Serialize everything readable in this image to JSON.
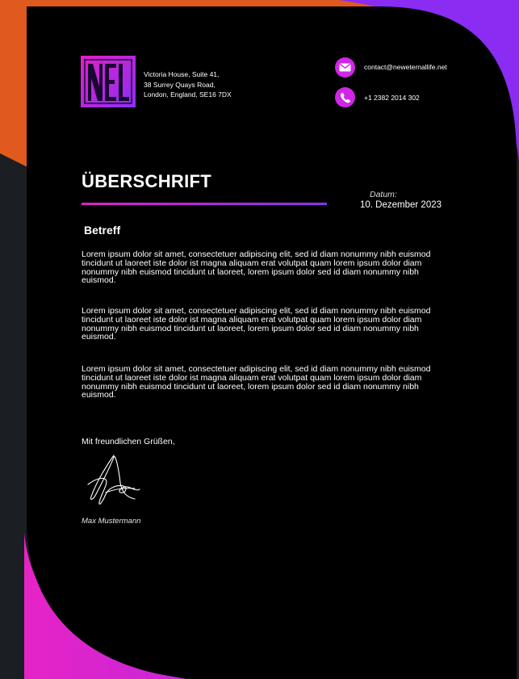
{
  "brand": {
    "logo_text": "NEL",
    "colors": {
      "magenta": "#e020c8",
      "purple": "#8a30f0",
      "orange": "#e0591f",
      "background": "#000000"
    }
  },
  "address": {
    "line1": "Victoria House, Suite 41,",
    "line2": "38 Surrey Quays Road,",
    "line3": "London, England, SE16 7DX"
  },
  "contact": {
    "email_icon": "envelope-icon",
    "email": "contact@neweternallife.net",
    "phone_icon": "phone-icon",
    "phone": "+1 2382 2014 302"
  },
  "document": {
    "heading": "ÜBERSCHRIFT",
    "date_label": "Datum:",
    "date_value": "10. Dezember 2023",
    "subject": "Betreff",
    "paragraphs": [
      "Lorem ipsum dolor sit amet, consectetuer adipiscing elit, sed id diam nonummy nibh euismod tincidunt ut laoreet iste dolor ist magna aliquam erat volutpat quam lorem ipsum dolor diam nonummy nibh euismod tincidunt ut laoreet, lorem ipsum dolor sed id diam nonummy nibh euismod.",
      "Lorem ipsum dolor sit amet, consectetuer adipiscing elit, sed id diam nonummy nibh euismod tincidunt ut laoreet iste dolor ist magna aliquam erat volutpat quam lorem ipsum dolor diam nonummy nibh euismod tincidunt ut laoreet, lorem ipsum dolor sed id diam nonummy nibh euismod.",
      "Lorem ipsum dolor sit amet, consectetuer adipiscing elit, sed id diam nonummy nibh euismod tincidunt ut laoreet iste dolor ist magna aliquam erat volutpat quam lorem ipsum dolor diam nonummy nibh euismod tincidunt ut laoreet, lorem ipsum dolor sed id diam nonummy nibh euismod."
    ],
    "closing": "Mit freundlichen Grüßen,",
    "signer_name": "Max Mustermann"
  }
}
